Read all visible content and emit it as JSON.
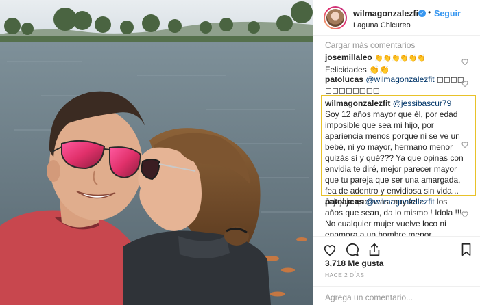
{
  "post": {
    "username": "wilmagonzalezfit",
    "follow_label": "Seguir",
    "dot": "•",
    "verified_glyph": "✓",
    "location": "Laguna Chicureo",
    "load_more": "Cargar más comentarios",
    "likes": "3,718 Me gusta",
    "date": "HACE 2 DÍAS",
    "add_comment_placeholder": "Agrega un comentario..."
  },
  "comments": [
    {
      "user": "josemillaleo",
      "line1": "👏👏👏👏👏👏",
      "line2": "Felicidades 👏👏"
    },
    {
      "user": "patolucas",
      "mention": "@wilmagonzalezfit",
      "line1_rest": " ◻◻◻◻",
      "line2": "◻◻◻◻◻◻◻◻"
    },
    {
      "user": "wilmagonzalezfit",
      "mention": "@jessibascur79",
      "text": " Soy 12 años mayor que él, por edad imposible que sea mi hijo, por apariencia menos porque ni se ve un bebé, ni yo mayor, hermano menor quizás sí y qué??? Ya que opinas con envidia te diré, mejor parecer mayor que tu pareja que ser una amargada, fea de adentro y envidiosa sin vida... Jajajaja que seas muy feliz."
    },
    {
      "user": "patolucas",
      "mention": "@wilmagonzalezfit",
      "text": " los años que sean, da lo mismo ! Idola !!! No cualquier mujer vuelve loco ni enamora a un hombre menor."
    }
  ],
  "icons": {
    "heart": "heart-outline-icon",
    "comment": "speech-bubble-icon",
    "share": "share-icon",
    "bookmark": "bookmark-icon"
  }
}
